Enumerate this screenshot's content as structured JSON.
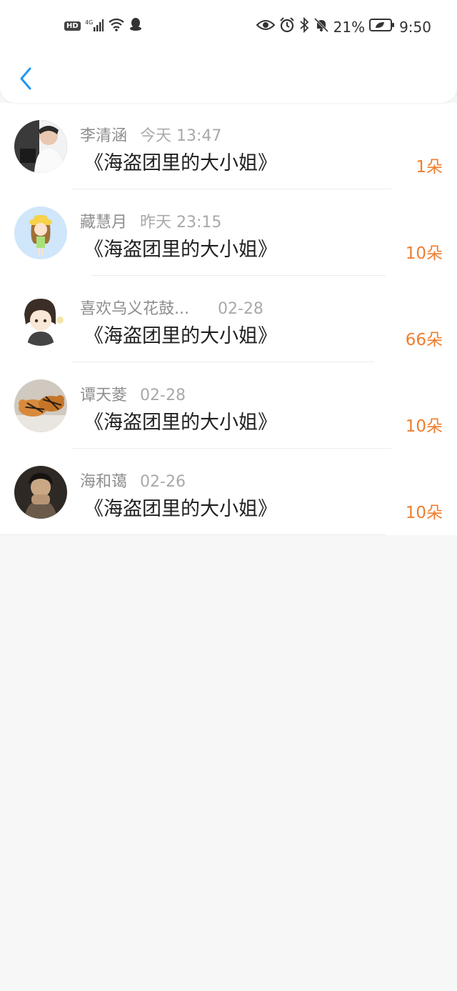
{
  "status_bar": {
    "battery": "21%",
    "time": "9:50",
    "network": "4G",
    "hd_label": "HD"
  },
  "colors": {
    "accent": "#2196f3",
    "count": "#f07d2e",
    "background": "#f8f7f8"
  },
  "items": [
    {
      "name": "李清涵",
      "time": "今天 13:47",
      "title": "《海盗团里的大小姐》",
      "count": "1朵"
    },
    {
      "name": "藏慧月",
      "time": "昨天 23:15",
      "title": "《海盗团里的大小姐》",
      "count": "10朵"
    },
    {
      "name": "喜欢乌义花鼓...",
      "time": "02-28",
      "title": "《海盗团里的大小姐》",
      "count": "66朵"
    },
    {
      "name": "谭天菱",
      "time": "02-28",
      "title": "《海盗团里的大小姐》",
      "count": "10朵"
    },
    {
      "name": "海和蔼",
      "time": "02-26",
      "title": "《海盗团里的大小姐》",
      "count": "10朵"
    }
  ]
}
